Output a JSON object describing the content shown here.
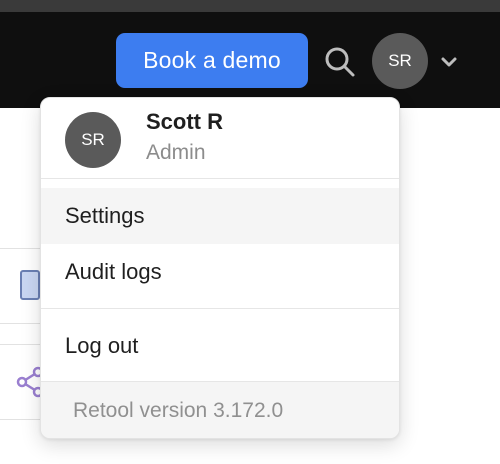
{
  "header": {
    "demo_button_label": "Book a demo",
    "search_icon": "search-icon",
    "avatar_initials": "SR",
    "chevron_icon": "chevron-down-icon"
  },
  "user_menu": {
    "avatar_initials": "SR",
    "user_name": "Scott R",
    "user_role": "Admin",
    "items": [
      {
        "label": "Settings",
        "highlighted": true
      },
      {
        "label": "Audit logs",
        "highlighted": false
      },
      {
        "label": "Log out",
        "highlighted": false
      }
    ],
    "version_text": "Retool version 3.172.0"
  },
  "colors": {
    "header_bg": "#0f0f0f",
    "accent": "#3d7df0",
    "avatar_bg": "#5a5a5a"
  }
}
